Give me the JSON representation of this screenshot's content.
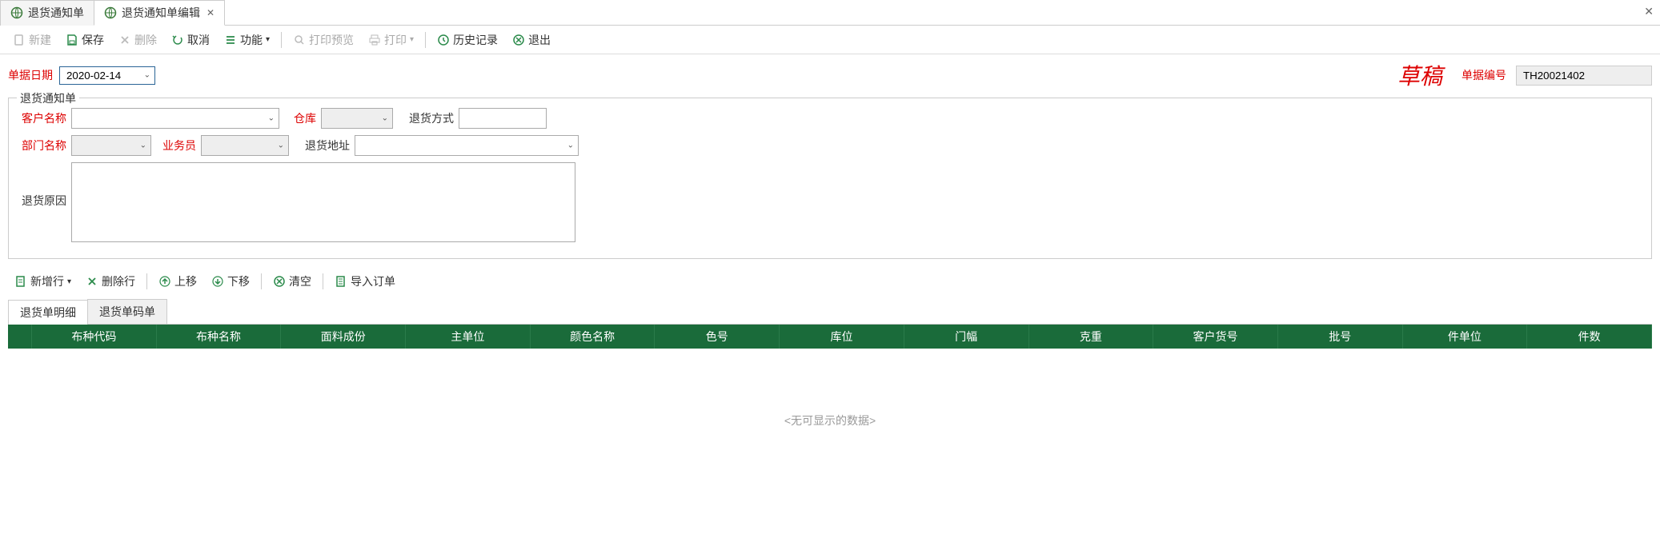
{
  "tabs": [
    {
      "label": "退货通知单",
      "active": false
    },
    {
      "label": "退货通知单编辑",
      "active": true
    }
  ],
  "toolbar": {
    "new": "新建",
    "save": "保存",
    "delete": "删除",
    "cancel": "取消",
    "functions": "功能",
    "print_preview": "打印预览",
    "print": "打印",
    "history": "历史记录",
    "exit": "退出"
  },
  "header": {
    "date_label": "单据日期",
    "date_value": "2020-02-14",
    "status": "草稿",
    "doc_no_label": "单据编号",
    "doc_no_value": "TH20021402"
  },
  "form": {
    "legend": "退货通知单",
    "customer_label": "客户名称",
    "customer_value": "",
    "warehouse_label": "仓库",
    "warehouse_value": "",
    "return_method_label": "退货方式",
    "return_method_value": "",
    "dept_label": "部门名称",
    "dept_value": "",
    "salesman_label": "业务员",
    "salesman_value": "",
    "return_addr_label": "退货地址",
    "return_addr_value": "",
    "return_reason_label": "退货原因",
    "return_reason_value": ""
  },
  "sub_toolbar": {
    "add_row": "新增行",
    "del_row": "删除行",
    "move_up": "上移",
    "move_down": "下移",
    "clear": "清空",
    "import_order": "导入订单"
  },
  "detail_tabs": [
    {
      "label": "退货单明细",
      "active": true
    },
    {
      "label": "退货单码单",
      "active": false
    }
  ],
  "grid": {
    "columns": [
      "布种代码",
      "布种名称",
      "面料成份",
      "主单位",
      "颜色名称",
      "色号",
      "库位",
      "门幅",
      "克重",
      "客户货号",
      "批号",
      "件单位",
      "件数"
    ],
    "empty_text": "<无可显示的数据>"
  }
}
